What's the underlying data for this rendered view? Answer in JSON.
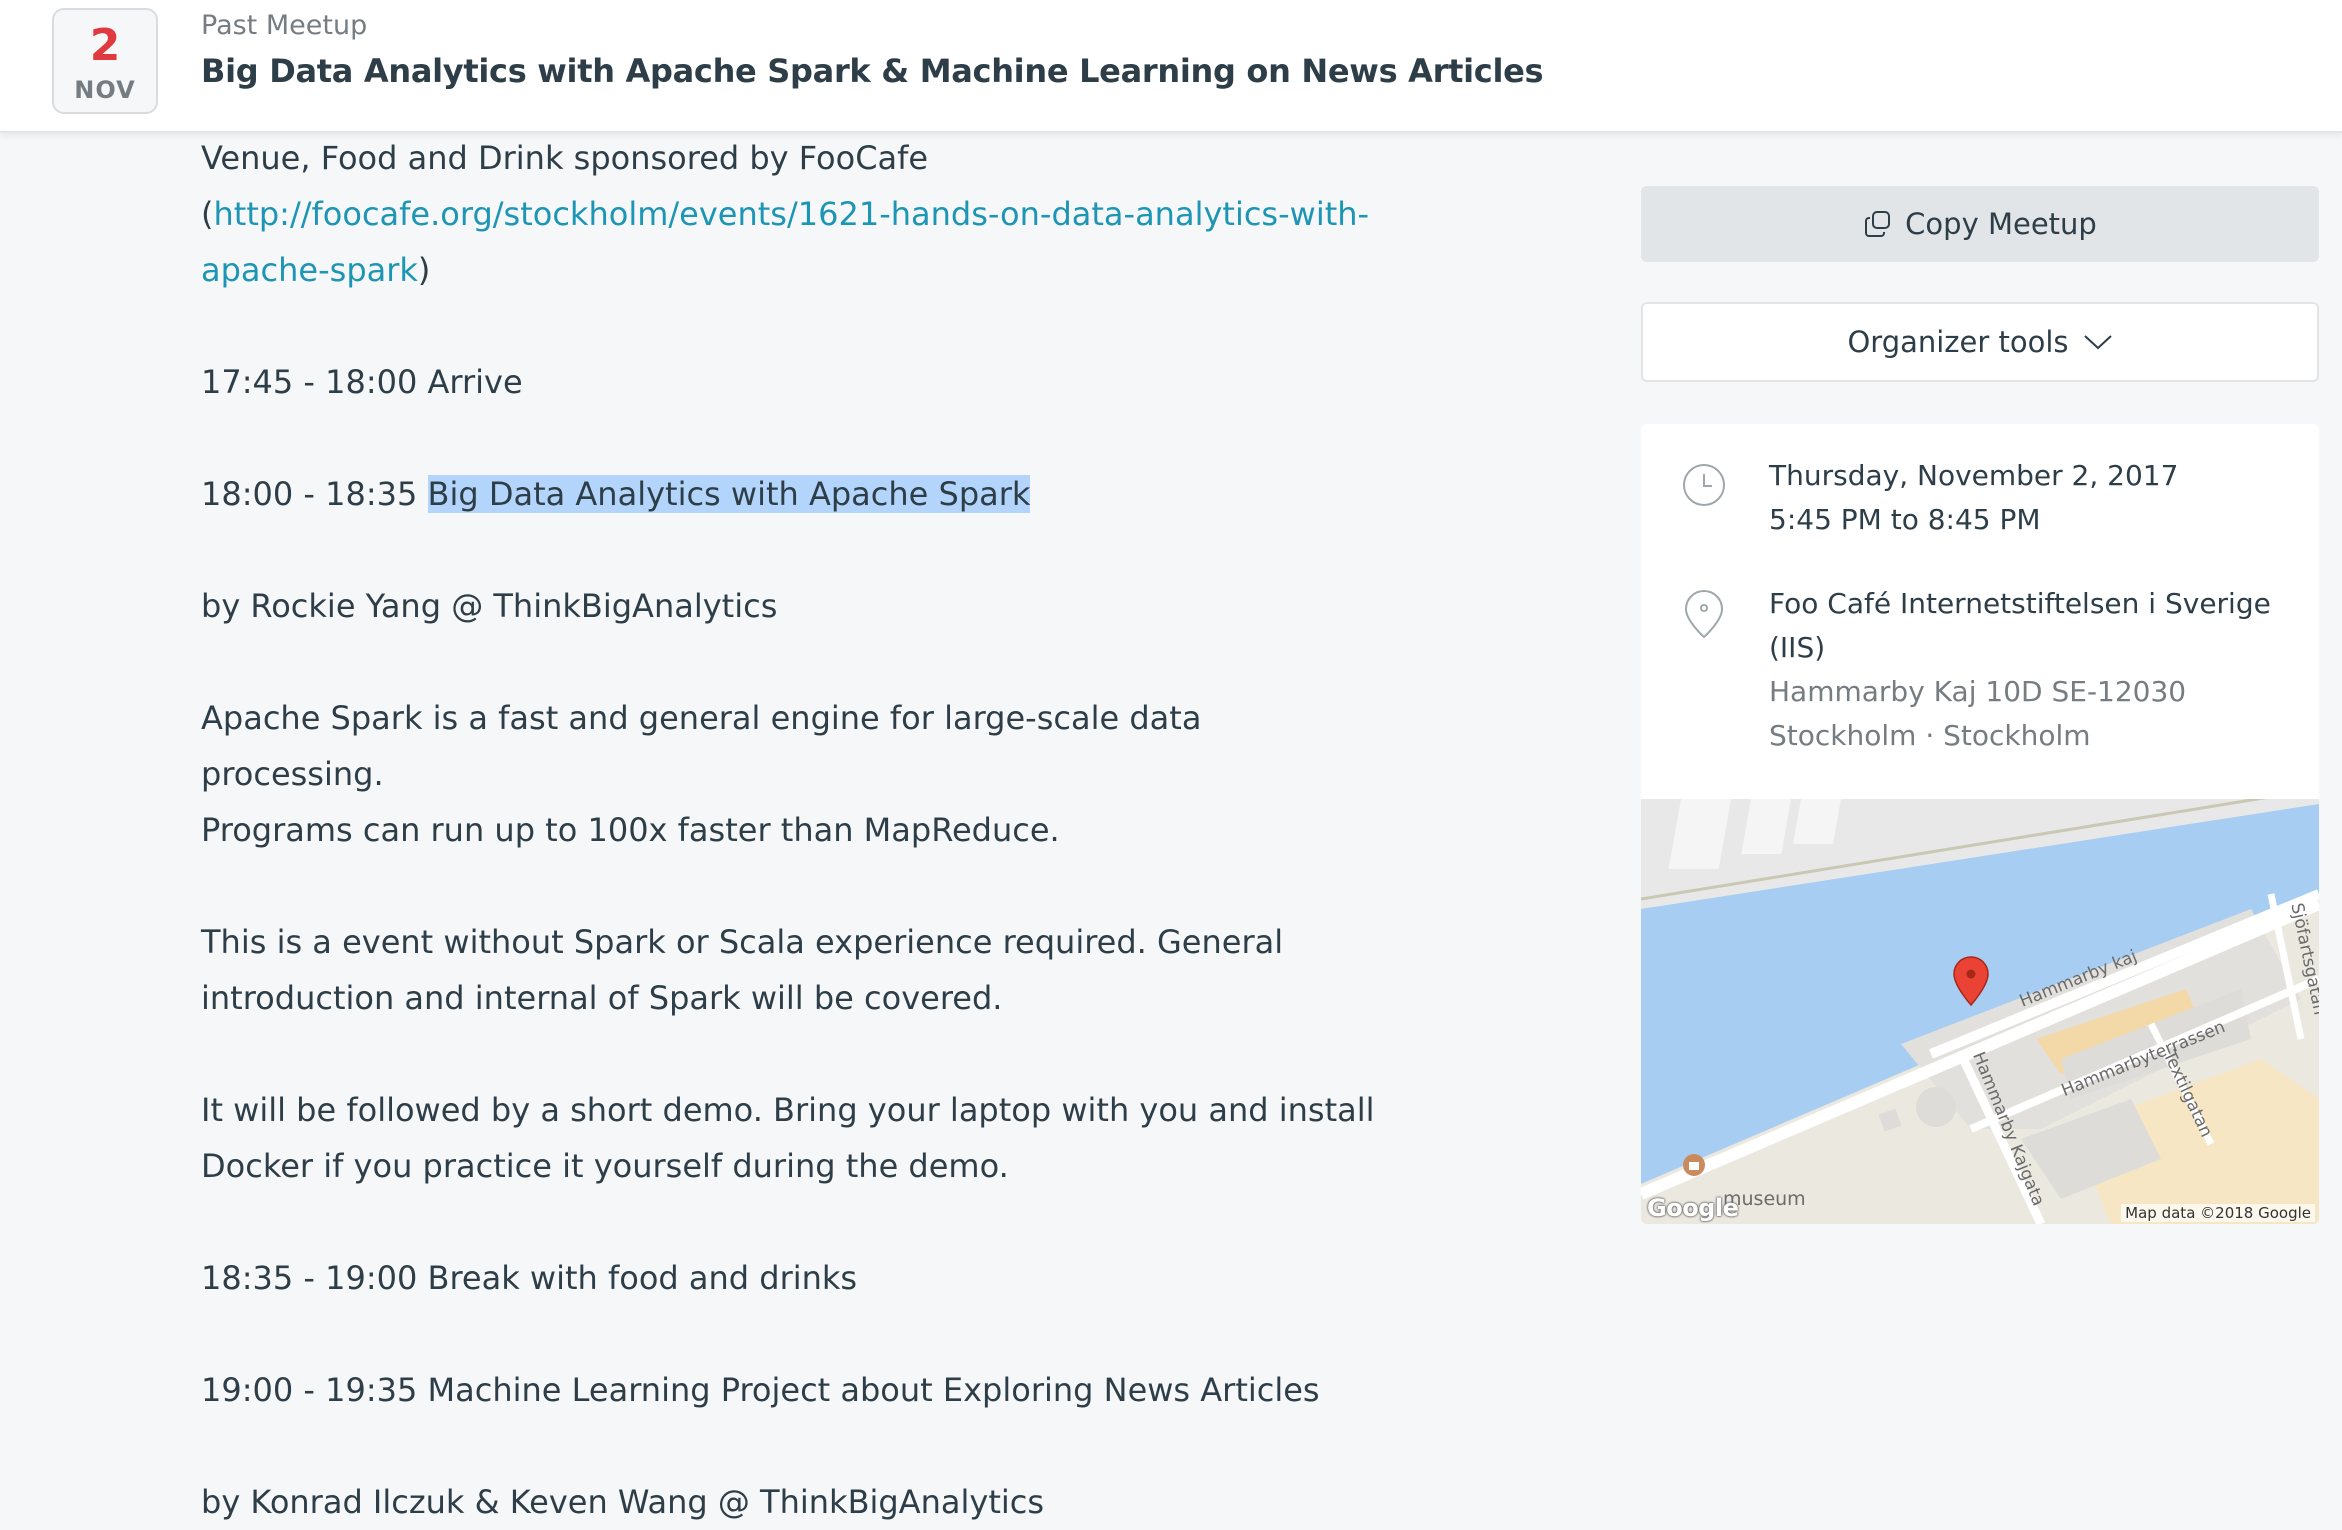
{
  "header": {
    "day": "2",
    "month": "NOV",
    "kicker": "Past Meetup",
    "title": "Big Data Analytics with Apache Spark & Machine Learning on News Articles"
  },
  "description": {
    "sponsor_text": "Venue, Food and Drink sponsored by FooCafe",
    "sponsor_link_part1": "http://foocafe.org/stockholm/events/1621-hands-on-data-analytics-with-",
    "sponsor_link_part2": "apache-spark",
    "open_paren": "(",
    "close_paren": ")",
    "arrive": "17:45 - 18:00 Arrive",
    "talk1_time": "18:00 - 18:35 ",
    "talk1_title": "Big Data Analytics with Apache Spark",
    "talk1_by": "by Rockie Yang @ ThinkBigAnalytics",
    "spark_line1": "Apache Spark is a fast and general engine for large-scale data processing.",
    "spark_line2": "Programs can run up to 100x faster than MapReduce.",
    "event_line1": "This is a event without Spark or Scala experience required. General",
    "event_line2": "introduction and internal of Spark will be covered.",
    "demo_line1": "It will be followed by a short demo. Bring your laptop with you and install",
    "demo_line2": "Docker if you practice it yourself during the demo.",
    "break": "18:35 - 19:00 Break with food and drinks",
    "talk2": "19:00 - 19:35 Machine Learning Project about Exploring News Articles",
    "talk2_by": "by Konrad Ilczuk & Keven Wang @ ThinkBigAnalytics"
  },
  "sidebar": {
    "copy_label": "Copy Meetup",
    "organizer_label": "Organizer tools",
    "date": "Thursday, November 2, 2017",
    "time": "5:45 PM to 8:45 PM",
    "venue_name": "Foo Café Internetstiftelsen i Sverige (IIS)",
    "address_line1": "Hammarby Kaj 10D SE-12030",
    "address_line2": "Stockholm · Stockholm",
    "icons": {
      "copy": "copy-icon",
      "chevron": "chevron-down-icon",
      "clock": "clock-icon",
      "pin": "location-pin-icon"
    }
  },
  "map": {
    "street1": "Hammarby kaj",
    "street2": "Hammarbyterrassen",
    "street3": "Hammarby Kajgata",
    "street4": "Textilgatan",
    "street5": "Sjöfartsgatan",
    "poi": "museum",
    "brand": "Google",
    "attribution": "Map data ©2018 Google"
  }
}
